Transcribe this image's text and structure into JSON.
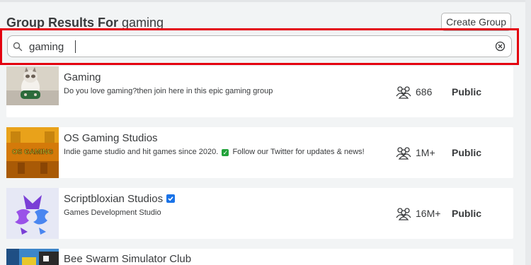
{
  "header": {
    "title_prefix": "Group Results For",
    "keyword": "gaming",
    "create_button": "Create Group"
  },
  "search": {
    "value": "gaming",
    "icon": "search-icon",
    "clear_icon": "clear-icon"
  },
  "groups": [
    {
      "name": "Gaming",
      "description": "Do you love gaming?then join here in this epic gaming group",
      "members": "686",
      "privacy": "Public",
      "thumbnail": "cat-photo"
    },
    {
      "name": "OS Gaming Studios",
      "description_a": "Indie game studio and hit games since 2020.",
      "description_b": "Follow our Twitter for updates & news!",
      "members": "1M+",
      "privacy": "Public",
      "thumbnail": "os-gaming-logo",
      "thumb_text": "OS GAMING"
    },
    {
      "name": "Scriptbloxian Studios",
      "verified": true,
      "description": "Games Development Studio",
      "members": "16M+",
      "privacy": "Public",
      "thumbnail": "ss-logo"
    },
    {
      "name": "Bee Swarm Simulator Club",
      "thumbnail": "bee-swarm-image"
    }
  ],
  "colors": {
    "highlight": "#e3000f",
    "background": "#f2f4f5",
    "text": "#393b3d",
    "verified": "#1a73e8"
  }
}
